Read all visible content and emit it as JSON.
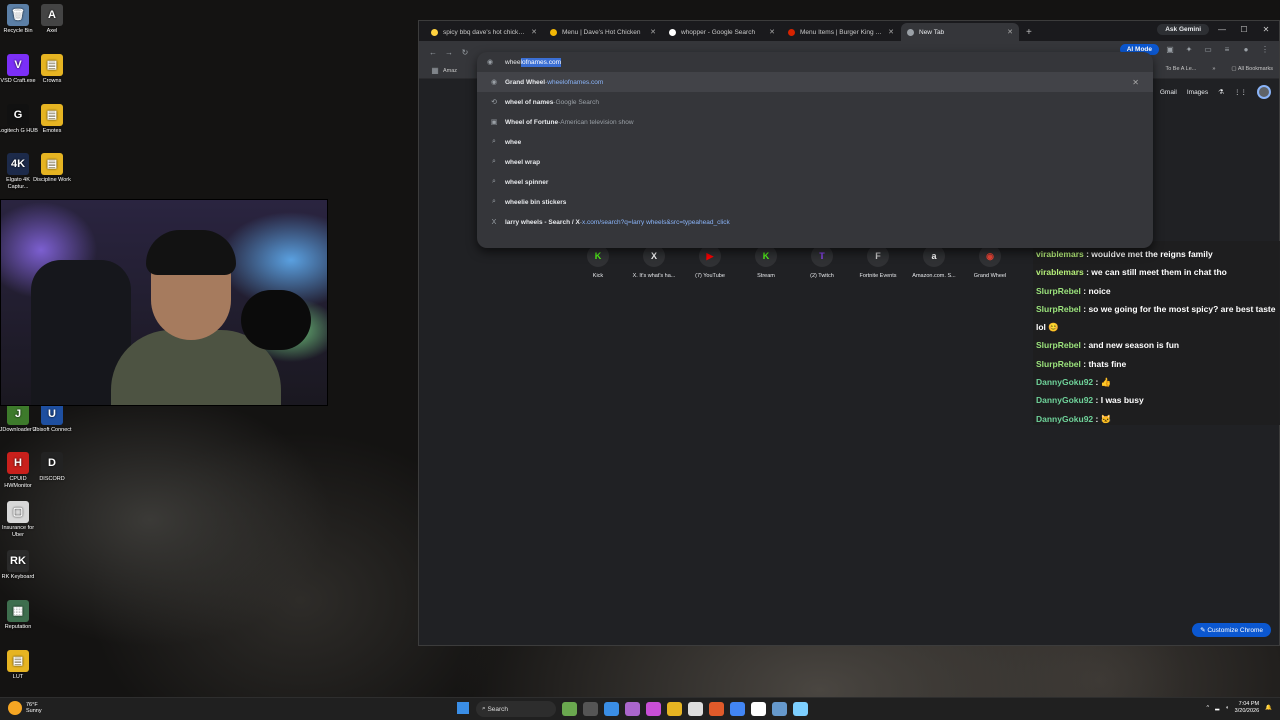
{
  "desktop": {
    "icons": [
      {
        "label": "Recycle Bin",
        "glyph": "🗑",
        "color": "#5b7fa6"
      },
      {
        "label": "Axel",
        "glyph": "A",
        "color": "#444444"
      },
      {
        "label": "VSD Craft.exe",
        "glyph": "V",
        "color": "#7b2ff7"
      },
      {
        "label": "Crowns",
        "glyph": "▤",
        "color": "#e6b422"
      },
      {
        "label": "Logitech G HUB",
        "glyph": "G",
        "color": "#111111"
      },
      {
        "label": "Emotes",
        "glyph": "▤",
        "color": "#e6b422"
      },
      {
        "label": "Elgato 4K Captur...",
        "glyph": "4K",
        "color": "#1c2a4a"
      },
      {
        "label": "Discipline Work",
        "glyph": "▤",
        "color": "#e6b422"
      },
      {
        "label": "JDownloader 2",
        "glyph": "J",
        "color": "#3d7a2b"
      },
      {
        "label": "Ubisoft Connect",
        "glyph": "U",
        "color": "#1e4fa0"
      },
      {
        "label": "CPUID HWMonitor",
        "glyph": "H",
        "color": "#c9201c"
      },
      {
        "label": "DISCORD",
        "glyph": "D",
        "color": "#222222"
      },
      {
        "label": "Insurance for Uber",
        "glyph": "▢",
        "color": "#d8d8d8"
      },
      {
        "label": "RK Keyboard",
        "glyph": "RK",
        "color": "#2a2a2a"
      },
      {
        "label": "Reputation",
        "glyph": "▦",
        "color": "#3e6e4e"
      },
      {
        "label": "LUT",
        "glyph": "▤",
        "color": "#e6b422"
      }
    ]
  },
  "browser": {
    "tabs": [
      {
        "label": "spicy bbq dave's hot chicken b",
        "color": "#ffd23f",
        "active": false
      },
      {
        "label": "Menu | Dave's Hot Chicken",
        "color": "#f2b705",
        "active": false
      },
      {
        "label": "whopper - Google Search",
        "color": "#ffffff",
        "active": false
      },
      {
        "label": "Menu Items | Burger King New",
        "color": "#d62300",
        "active": false
      },
      {
        "label": "New Tab",
        "color": "#9aa0a6",
        "active": true
      }
    ],
    "new_tab_symbol": "+",
    "close_symbol": "✕",
    "ask_gemini": "Ask Gemini",
    "window_controls": {
      "minimize": "—",
      "maximize": "☐",
      "close": "✕"
    },
    "omnibox": {
      "typed": "whee",
      "autocomplete": "lofnames.com",
      "suggestions": [
        {
          "icon": "◉",
          "bold": "Grand Wheel",
          "separator": " - ",
          "detail": "wheelofnames.com",
          "detail_type": "url",
          "remove": "✕"
        },
        {
          "icon": "⟲",
          "bold": "wheel of names",
          "separator": " - ",
          "detail": "Google Search",
          "detail_type": "sub"
        },
        {
          "icon": "▣",
          "bold": "Wheel of Fortune",
          "separator": " - ",
          "detail": "American television show",
          "detail_type": "sub"
        },
        {
          "icon": "⌕",
          "bold": "whee",
          "separator": "",
          "detail": "",
          "detail_type": "sub"
        },
        {
          "icon": "⌕",
          "bold": "wheel wrap",
          "separator": "",
          "detail": "",
          "detail_type": "sub"
        },
        {
          "icon": "⌕",
          "bold": "wheel spinner",
          "separator": "",
          "detail": "",
          "detail_type": "sub"
        },
        {
          "icon": "⌕",
          "bold": "wheelie bin stickers",
          "separator": "",
          "detail": "",
          "detail_type": "sub"
        },
        {
          "icon": "X",
          "bold": "larry wheels - Search / X",
          "separator": " - ",
          "detail": "x.com/search?q=larry wheels&src=typeahead_click",
          "detail_type": "url"
        }
      ]
    },
    "ai_mode": "AI Mode",
    "bookmarks": {
      "first": "Amaz",
      "right_label": "To Be A Le...",
      "all_bookmarks": "All Bookmarks"
    },
    "ntp": {
      "gmail": "Gmail",
      "images": "Images",
      "shortcuts": [
        {
          "label": "Kick",
          "glyph": "K",
          "color": "#53fc18"
        },
        {
          "label": "X. It's what's ha...",
          "glyph": "X",
          "color": "#ffffff"
        },
        {
          "label": "(7) YouTube",
          "glyph": "▶",
          "color": "#ff0000"
        },
        {
          "label": "Stream",
          "glyph": "K",
          "color": "#53fc18"
        },
        {
          "label": "(2) Twitch",
          "glyph": "T",
          "color": "#9146ff"
        },
        {
          "label": "Fortnite Events",
          "glyph": "F",
          "color": "#cccccc"
        },
        {
          "label": "Amazon.com. S...",
          "glyph": "a",
          "color": "#ffffff"
        },
        {
          "label": "Grand Wheel",
          "glyph": "◉",
          "color": "#ea4335"
        }
      ],
      "customize": "Customize Chrome"
    }
  },
  "chat": {
    "messages": [
      {
        "user": "virablemars",
        "text": "wouldve met the reigns family",
        "color": "#b6f07a"
      },
      {
        "user": "virablemars",
        "text": "we can still meet them in chat tho",
        "color": "#b6f07a"
      },
      {
        "user": "SlurpRebel",
        "text": "noice",
        "color": "#9be37c"
      },
      {
        "user": "SlurpRebel",
        "text": "so we going for the most spicy? are best taste lol 😊",
        "color": "#9be37c"
      },
      {
        "user": "SlurpRebel",
        "text": "and new season is fun",
        "color": "#9be37c"
      },
      {
        "user": "SlurpRebel",
        "text": "thats fine",
        "color": "#9be37c"
      },
      {
        "user": "DannyGoku92",
        "text": "👍",
        "color": "#6fd39a"
      },
      {
        "user": "DannyGoku92",
        "text": "I was busy",
        "color": "#6fd39a"
      },
      {
        "user": "DannyGoku92",
        "text": "🐱",
        "color": "#6fd39a"
      }
    ]
  },
  "taskbar": {
    "weather_temp": "76°F",
    "weather_desc": "Sunny",
    "search": "Search",
    "time": "7:04 PM",
    "date": "3/20/2026",
    "apps": [
      "#6aa84f",
      "#555555",
      "#3a8ee6",
      "#aa66cc",
      "#c94fd6",
      "#e6b422",
      "#dddddd",
      "#e05a2a",
      "#4285f4",
      "#ffffff",
      "#6699cc",
      "#7dcfff"
    ]
  }
}
